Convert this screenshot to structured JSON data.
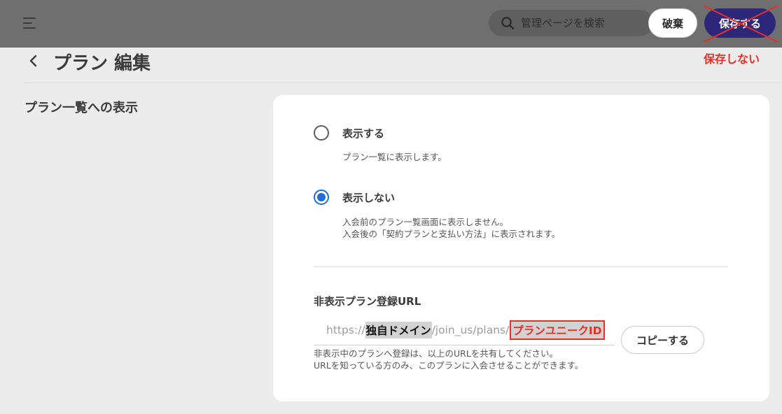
{
  "header": {
    "search_placeholder": "管理ページを検索",
    "discard_label": "破棄",
    "save_label": "保存する",
    "no_save_note": "保存しない"
  },
  "page": {
    "title": "プラン 編集"
  },
  "section": {
    "label": "プラン一覧への表示"
  },
  "options": [
    {
      "label": "表示する",
      "selected": false,
      "description": [
        "プラン一覧に表示します。"
      ]
    },
    {
      "label": "表示しない",
      "selected": true,
      "description": [
        "入会前のプラン一覧画面に表示しません。",
        "入会後の「契約プランと支払い方法」に表示されます。"
      ]
    }
  ],
  "hidden_url": {
    "title": "非表示プラン登録URL",
    "prefix": "https://",
    "domain": "独自ドメイン",
    "path": "/join_us/plans/",
    "plan_id": "プランユニークID",
    "copy_label": "コピーする",
    "help": [
      "非表示中のプランへ登録は、以上のURLを共有してください。",
      "URLを知っている方のみ、このプランに入会させることができます。"
    ]
  },
  "colors": {
    "accent": "#2c2779",
    "radio_selected": "#1f6fd9",
    "annotation_red": "#e53027"
  },
  "icons": {
    "menu": "hamburger-icon",
    "search": "search-icon",
    "back": "chevron-left-icon"
  }
}
